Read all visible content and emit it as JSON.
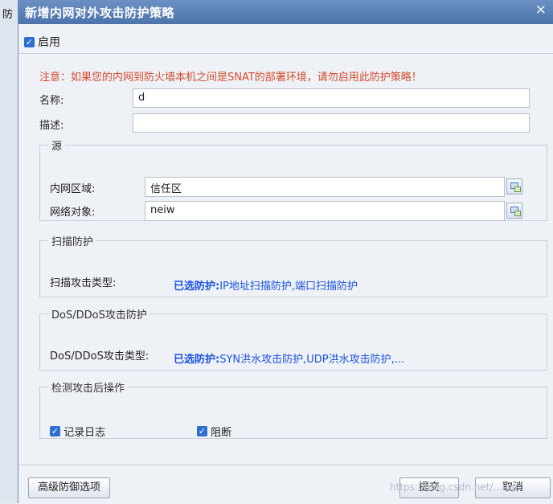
{
  "background": {
    "tab_label": "防"
  },
  "dialog": {
    "title": "新增内网对外攻击防护策略",
    "close_glyph": "✕",
    "enable_label": "启用",
    "notice": "注意：如果您的内网到防火墙本机之间是SNAT的部署环境，请勿启用此防护策略！",
    "name_label": "名称:",
    "name_value": "d",
    "desc_label": "描述:",
    "desc_value": "",
    "source": {
      "legend": "源",
      "zone_label": "内网区域:",
      "zone_value": "信任区",
      "object_label": "网络对象:",
      "object_value": "neiw"
    },
    "scan": {
      "legend": "扫描防护",
      "type_label": "扫描攻击类型:",
      "selected_prefix": "已选防护:",
      "selected_value": "IP地址扫描防护,端口扫描防护"
    },
    "dos": {
      "legend": "DoS/DDoS攻击防护",
      "type_label": "DoS/DDoS攻击类型:",
      "selected_prefix": "已选防护:",
      "selected_value": "SYN洪水攻击防护,UDP洪水攻击防护,..."
    },
    "action": {
      "legend": "检测攻击后操作",
      "log_label": "记录日志",
      "block_label": "阻断"
    },
    "footer": {
      "advanced_label": "高级防御选项",
      "submit_label": "提交",
      "cancel_label": "取消",
      "watermark": "https://blog.csdn.net/...mp"
    }
  }
}
